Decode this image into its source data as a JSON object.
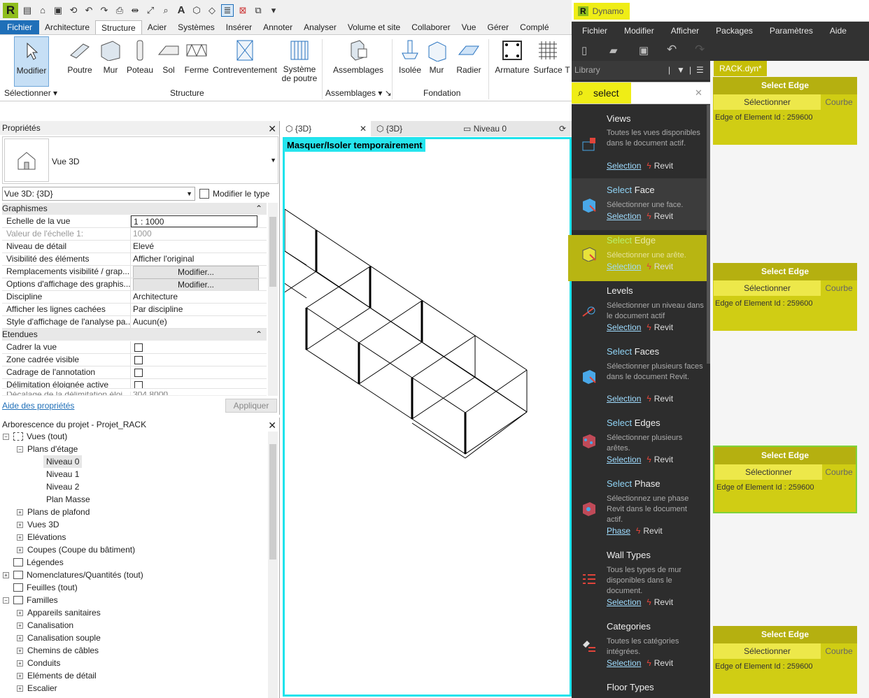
{
  "ribbon_tabs": [
    "Fichier",
    "Architecture",
    "Structure",
    "Acier",
    "Systèmes",
    "Insérer",
    "Annoter",
    "Analyser",
    "Volume et site",
    "Collaborer",
    "Vue",
    "Gérer",
    "Complé"
  ],
  "ribbon": {
    "buttons": [
      "Modifier",
      "Poutre",
      "Mur",
      "Poteau",
      "Sol",
      "Ferme",
      "Contreventement",
      "Système de poutre",
      "Assemblages",
      "Isolée",
      "Mur",
      "Radier",
      "Armature",
      "Surface",
      "T"
    ],
    "systeme_line1": "Système",
    "systeme_line2": "de poutre",
    "panels": {
      "select": "Sélectionner",
      "structure": "Structure",
      "assemblages": "Assemblages",
      "fondation": "Fondation"
    }
  },
  "properties": {
    "title": "Propriétés",
    "type_name": "Vue 3D",
    "view_selector": "Vue 3D: {3D}",
    "edit_type": "Modifier le type",
    "cat_graphics": "Graphismes",
    "cat_extents": "Etendues",
    "rows": [
      {
        "k": "Echelle de la vue",
        "v": "1 : 1000"
      },
      {
        "k": "Valeur de l'échelle    1:",
        "v": "1000"
      },
      {
        "k": "Niveau de détail",
        "v": "Elevé"
      },
      {
        "k": "Visibilité des éléments",
        "v": "Afficher l'original"
      },
      {
        "k": "Remplacements visibilité / grap...",
        "v": "Modifier..."
      },
      {
        "k": "Options d'affichage des graphis...",
        "v": "Modifier..."
      },
      {
        "k": "Discipline",
        "v": "Architecture"
      },
      {
        "k": "Afficher les lignes cachées",
        "v": "Par discipline"
      },
      {
        "k": "Style d'affichage de l'analyse pa...",
        "v": "Aucun(e)"
      }
    ],
    "extent_rows": [
      {
        "k": "Cadrer la vue"
      },
      {
        "k": "Zone cadrée visible"
      },
      {
        "k": "Cadrage de l'annotation"
      },
      {
        "k": "Délimitation éloignée active"
      },
      {
        "k": "Décalage de la délimitation éloi...",
        "v": "304.8000"
      }
    ],
    "help_link": "Aide des propriétés",
    "apply": "Appliquer"
  },
  "tree": {
    "title": "Arborescence du projet - Projet_RACK",
    "nodes": [
      "Vues (tout)",
      "Plans d'étage",
      "Niveau 0",
      "Niveau 1",
      "Niveau 2",
      "Plan Masse",
      "Plans de plafond",
      "Vues 3D",
      "Elévations",
      "Coupes (Coupe du bâtiment)",
      "Légendes",
      "Nomenclatures/Quantités (tout)",
      "Feuilles (tout)",
      "Familles",
      "Appareils sanitaires",
      "Canalisation",
      "Canalisation souple",
      "Chemins de câbles",
      "Conduits",
      "Eléments de détail",
      "Escalier"
    ]
  },
  "view_tabs": [
    "{3D}",
    "{3D}",
    "Niveau 0"
  ],
  "viewport": {
    "iso_label": "Masquer/Isoler temporairement"
  },
  "dynamo": {
    "title": "Dynamo",
    "menu": [
      "Fichier",
      "Modifier",
      "Afficher",
      "Packages",
      "Paramètres",
      "Aide"
    ],
    "library": "Library",
    "search_value": "select",
    "workspace_tab": "RACK.dyn*",
    "items": [
      {
        "title": "Views",
        "desc": "Toutes les vues disponibles dans le document actif.",
        "link": "Selection",
        "pkg": "Revit"
      },
      {
        "title_pre": "Select",
        "title_post": "Face",
        "desc": "Sélectionner une face.",
        "link": "Selection",
        "pkg": "Revit"
      },
      {
        "title_pre": "Select",
        "title_post": "Edge",
        "desc": "Sélectionner une arête.",
        "link": "Selection",
        "pkg": "Revit"
      },
      {
        "title": "Levels",
        "desc": "Sélectionner un niveau dans le document actif",
        "link": "Selection",
        "pkg": "Revit"
      },
      {
        "title_pre": "Select",
        "title_post": "Faces",
        "desc": "Sélectionner plusieurs faces dans le document Revit.",
        "link": "Selection",
        "pkg": "Revit"
      },
      {
        "title_pre": "Select",
        "title_post": "Edges",
        "desc": "Sélectionner plusieurs arêtes.",
        "link": "Selection",
        "pkg": "Revit"
      },
      {
        "title_pre": "Select",
        "title_post": "Phase",
        "desc": "Sélectionnez une phase Revit dans le document actif.",
        "link": "Phase",
        "pkg": "Revit"
      },
      {
        "title": "Wall Types",
        "desc": "Tous les types de mur disponibles dans le document.",
        "link": "Selection",
        "pkg": "Revit"
      },
      {
        "title": "Categories",
        "desc": "Toutes les catégories intégrées.",
        "link": "Selection",
        "pkg": "Revit"
      },
      {
        "title": "Floor Types"
      }
    ],
    "node": {
      "title": "Select Edge",
      "button": "Sélectionner",
      "tab": "Courbe",
      "output": "Edge of Element Id : 259600"
    }
  },
  "colors": {
    "highlight": "#efed16",
    "cyan": "#1ee3ec",
    "revit_green": "#8fbd1d",
    "file_tab": "#1f6fb8"
  }
}
